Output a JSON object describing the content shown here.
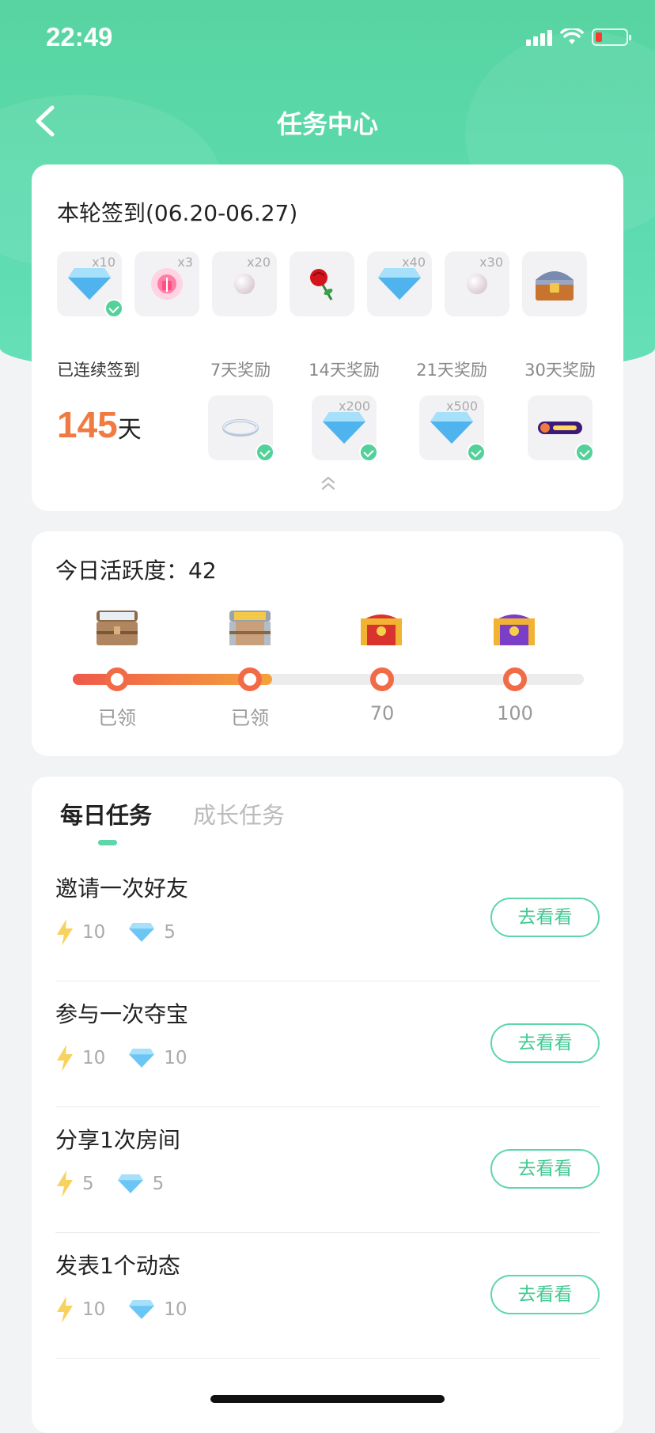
{
  "status_bar": {
    "time": "22:49",
    "battery_color": "#ff3b30"
  },
  "nav": {
    "title": "任务中心",
    "back_icon": "chevron-left-icon"
  },
  "sign_in": {
    "title": "本轮签到(06.20-06.27)",
    "daily_rewards": [
      {
        "icon": "diamond-icon",
        "qty": "x10",
        "checked": true
      },
      {
        "icon": "gift-icon",
        "qty": "x3",
        "checked": false
      },
      {
        "icon": "pearl-icon",
        "qty": "x20",
        "checked": false
      },
      {
        "icon": "rose-icon",
        "qty": "",
        "checked": false
      },
      {
        "icon": "diamond-icon",
        "qty": "x40",
        "checked": false
      },
      {
        "icon": "pearl-icon",
        "qty": "x30",
        "checked": false
      },
      {
        "icon": "treasure-chest-icon",
        "qty": "",
        "checked": false
      }
    ],
    "streak_label": "已连续签到",
    "streak_days": "145",
    "streak_unit": "天",
    "milestones": [
      {
        "label": "7天奖励",
        "icon": "ring-icon",
        "qty": "",
        "checked": true
      },
      {
        "label": "14天奖励",
        "icon": "diamond-icon",
        "qty": "x200",
        "checked": true
      },
      {
        "label": "21天奖励",
        "icon": "diamond-icon",
        "qty": "x500",
        "checked": true
      },
      {
        "label": "30天奖励",
        "icon": "badge-icon",
        "qty": "",
        "checked": true
      }
    ]
  },
  "activity": {
    "title": "今日活跃度：42",
    "progress_percent": 39,
    "nodes": [
      {
        "label": "已领",
        "chest": "wooden-chest-icon"
      },
      {
        "label": "已领",
        "chest": "silver-chest-icon"
      },
      {
        "label": "70",
        "chest": "red-chest-icon"
      },
      {
        "label": "100",
        "chest": "purple-chest-icon"
      }
    ]
  },
  "tasks": {
    "tabs": [
      "每日任务",
      "成长任务"
    ],
    "active_tab": 0,
    "button_label": "去看看",
    "items": [
      {
        "name": "邀请一次好友",
        "energy": "10",
        "diamond": "5"
      },
      {
        "name": "参与一次夺宝",
        "energy": "10",
        "diamond": "10"
      },
      {
        "name": "分享1次房间",
        "energy": "5",
        "diamond": "5"
      },
      {
        "name": "发表1个动态",
        "energy": "10",
        "diamond": "10"
      }
    ]
  },
  "colors": {
    "accent": "#5dd6a8",
    "streak": "#f07a40",
    "progress_start": "#ef5a4a",
    "progress_end": "#f4a23c"
  }
}
